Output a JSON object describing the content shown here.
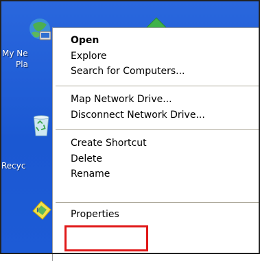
{
  "desktop": {
    "icons": [
      {
        "label_line1": "My Ne",
        "label_line2": "Pla",
        "icon": "network-places-icon"
      },
      {
        "label": "Recyc",
        "icon": "recycle-bin-icon"
      },
      {
        "icon": "shortcut-icon"
      }
    ]
  },
  "context_menu": {
    "items": [
      {
        "label": "Open",
        "bold": true
      },
      {
        "label": "Explore"
      },
      {
        "label": "Search for Computers..."
      },
      {
        "label": "Map Network Drive..."
      },
      {
        "label": "Disconnect Network Drive..."
      },
      {
        "label": "Create Shortcut"
      },
      {
        "label": "Delete"
      },
      {
        "label": "Rename"
      },
      {
        "label": "Properties",
        "highlighted": true
      }
    ]
  },
  "colors": {
    "desktop_blue": "#2a67dd",
    "menu_background": "#ffffff",
    "highlight_border": "#e01818"
  }
}
